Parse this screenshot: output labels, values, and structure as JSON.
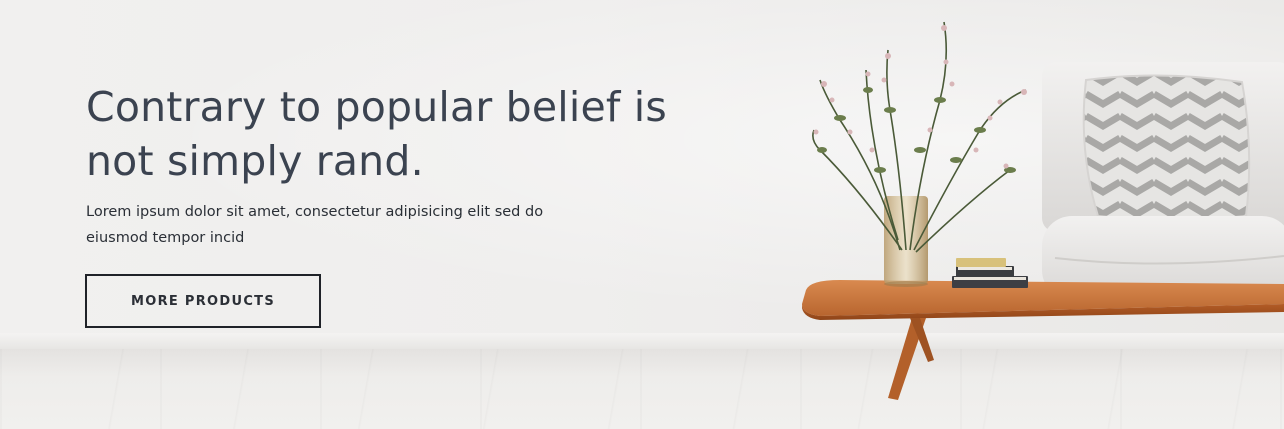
{
  "hero": {
    "title": "Contrary to popular belief is not simply rand.",
    "description": "Lorem ipsum dolor sit amet, consectetur adipisicing elit sed do eiusmod tempor incid",
    "cta_label": "MORE PRODUCTS"
  },
  "colors": {
    "title": "#3b4350",
    "text": "#2a2f36",
    "button_border": "#1f2228",
    "wall": "#efeeed",
    "wood": "#c7763d"
  }
}
